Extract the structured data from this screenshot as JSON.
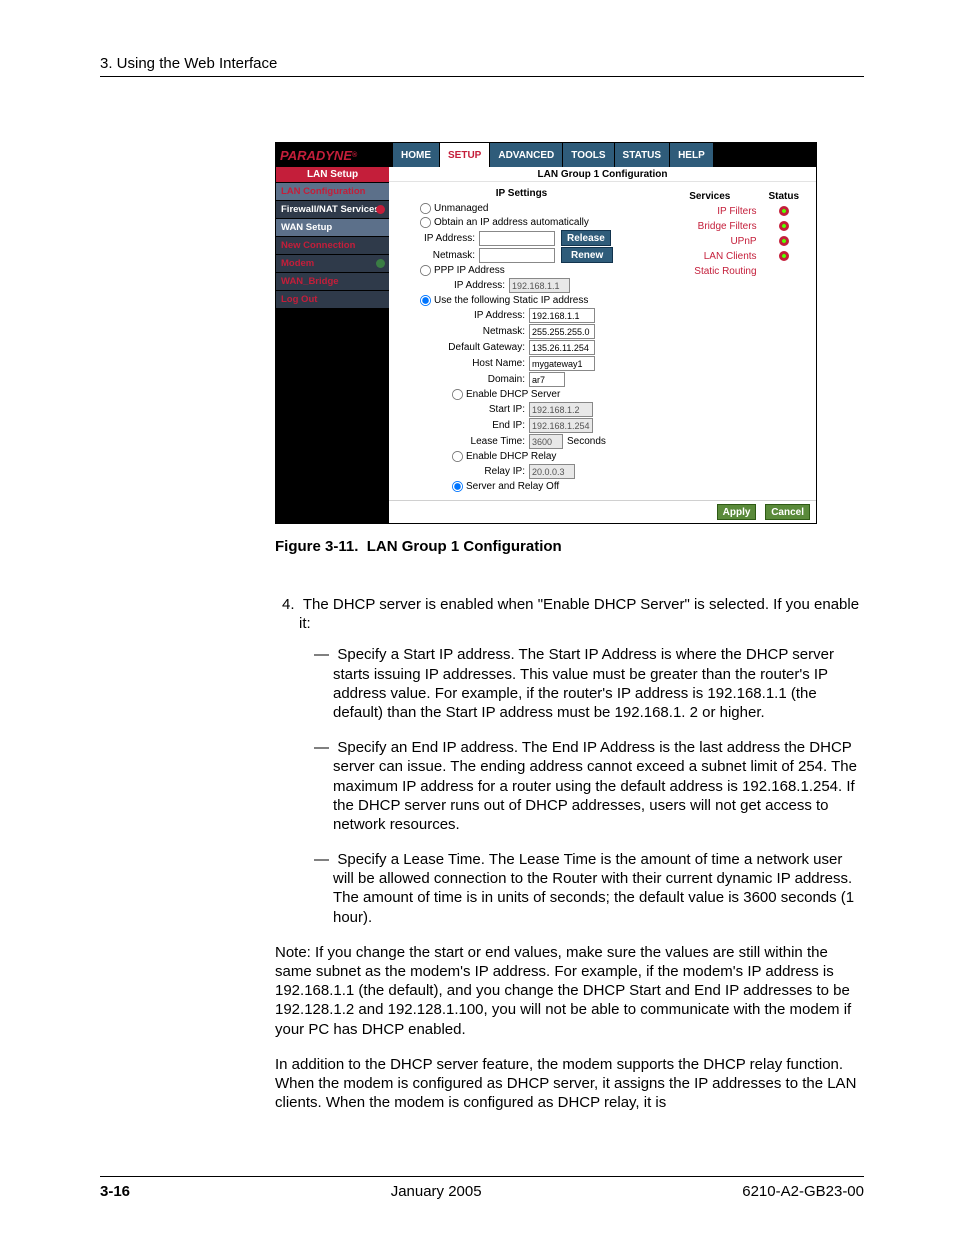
{
  "header": {
    "chapter": "3. Using the Web Interface"
  },
  "app": {
    "brand": "PARADYNE",
    "tabs": [
      "HOME",
      "SETUP",
      "ADVANCED",
      "TOOLS",
      "STATUS",
      "HELP"
    ],
    "activeTab": "SETUP",
    "sidebar": {
      "title": "LAN Setup",
      "items": [
        {
          "label": "LAN Configuration",
          "active": true
        },
        {
          "label": "Firewall/NAT Services",
          "dot": "red"
        },
        {
          "label": "WAN Setup"
        },
        {
          "label": "New Connection"
        },
        {
          "label": "Modem",
          "dot": "green"
        },
        {
          "label": "WAN_Bridge"
        },
        {
          "label": "Log Out"
        }
      ]
    },
    "content": {
      "title": "LAN Group 1 Configuration",
      "ipSettings": {
        "heading": "IP Settings",
        "radios": {
          "unmanaged": "Unmanaged",
          "obtain": "Obtain an IP address automatically",
          "ppp": "PPP IP Address",
          "useStatic": "Use the following Static IP address"
        },
        "labels": {
          "ipAddress": "IP Address:",
          "netmask": "Netmask:",
          "defaultGateway": "Default Gateway:",
          "hostName": "Host Name:",
          "domain": "Domain:",
          "enableDhcpServer": "Enable DHCP Server",
          "startIp": "Start IP:",
          "endIp": "End IP:",
          "leaseTime": "Lease Time:",
          "seconds": "Seconds",
          "enableDhcpRelay": "Enable DHCP Relay",
          "relayIp": "Relay IP:",
          "serverRelayOff": "Server and Relay Off"
        },
        "values": {
          "obtainIp": "",
          "obtainNetmask": "",
          "pppIp": "192.168.1.1",
          "staticIp": "192.168.1.1",
          "staticNetmask": "255.255.255.0",
          "gateway": "135.26.11.254",
          "hostName": "mygateway1",
          "domain": "ar7",
          "startIp": "192.168.1.2",
          "endIp": "192.168.1.254",
          "leaseTime": "3600",
          "relayIp": "20.0.0.3"
        },
        "buttons": {
          "release": "Release",
          "renew": "Renew"
        }
      },
      "services": {
        "heads": {
          "services": "Services",
          "status": "Status"
        },
        "rows": [
          "IP Filters",
          "Bridge Filters",
          "UPnP",
          "LAN Clients",
          "Static Routing"
        ]
      },
      "footerButtons": {
        "apply": "Apply",
        "cancel": "Cancel"
      }
    }
  },
  "figure": {
    "num": "Figure 3-11.",
    "title": "LAN Group 1 Configuration"
  },
  "text": {
    "olnum": "4.",
    "ol4": "The DHCP server is enabled when \"Enable DHCP Server\" is selected. If you enable it:",
    "d1": "Specify a Start IP address. The Start IP Address is where the DHCP server starts issuing IP addresses. This value must be greater than the router's IP address value. For example, if the router's IP address is 192.168.1.1 (the default) than the Start IP address must be 192.168.1. 2 or higher.",
    "d2": "Specify an End IP address. The End IP Address is the last address the DHCP server can issue. The ending address cannot exceed a subnet limit of 254. The maximum IP address for a router using the default address is 192.168.1.254. If the DHCP server runs out of DHCP addresses, users will not get access to network resources.",
    "d3": "Specify a Lease Time. The Lease Time is the amount of time a network user will be allowed connection to the Router with their current dynamic IP address. The amount of time is in units of seconds; the default value is 3600 seconds (1 hour).",
    "note": "Note: If you change the start or end values, make sure the values are still within the same subnet as the modem's IP address. For example, if the modem's IP address is 192.168.1.1 (the default), and you change the DHCP Start and End IP addresses to be 192.128.1.2 and 192.128.1.100, you will not be able to communicate with the modem if your PC has DHCP enabled.",
    "p2": "In addition to the DHCP server feature, the modem supports the DHCP relay function. When the modem is configured as DHCP server, it assigns the IP addresses to the LAN clients. When the modem is configured as DHCP relay, it is"
  },
  "footer": {
    "page": "3-16",
    "date": "January 2005",
    "doc": "6210-A2-GB23-00"
  }
}
